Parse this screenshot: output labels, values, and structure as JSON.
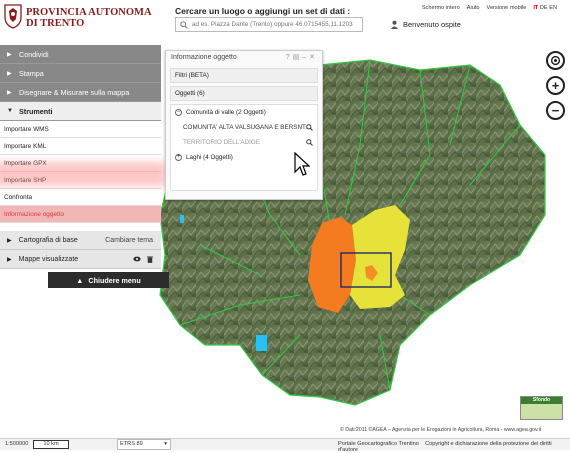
{
  "header": {
    "brand_line1": "PROVINCIA AUTONOMA",
    "brand_line2": "DI TRENTO",
    "search_title": "Cercare un luogo o aggiungi un set di dati :",
    "search_placeholder": "ad es. Piazza Dante (Trento) oppure 46.0715455,11.1203",
    "user_label": "Benvenuto ospite",
    "top_links": [
      "Schermo intero",
      "Aiuto",
      "Versione mobile"
    ],
    "lang_it": "IT",
    "lang_de": "DE",
    "lang_en": "EN"
  },
  "menu": {
    "items": [
      {
        "label": "Condividi"
      },
      {
        "label": "Stampa"
      },
      {
        "label": "Disegnare & Misurare sulla mappa"
      }
    ],
    "tools_label": "Strumenti",
    "tools": [
      {
        "label": "Importare WMS"
      },
      {
        "label": "Importare KML"
      },
      {
        "label": "Importare GPX"
      },
      {
        "label": "Importare SHP"
      },
      {
        "label": "Confronta"
      },
      {
        "label": "Informazione oggetto"
      }
    ],
    "base_map_label": "Cartografia di base",
    "change_theme_label": "Cambiare tema",
    "visible_maps_label": "Mappe visualizzate",
    "close_menu_label": "Chiudere menu"
  },
  "info_panel": {
    "title": "Informazione oggetto",
    "filter_label": "Filtri (BETA)",
    "objects_label": "Oggetti (6)",
    "group1_label": "Comunità di valle (2 Oggetti)",
    "group1_items": [
      "COMUNITA' ALTA VALSUGANA E BERSNT...",
      "TERRITORIO DELL'ADIGE"
    ],
    "group2_label": "Laghi (4 Oggetti)"
  },
  "map": {
    "credits": "© Dati:2011 ©AGEA – Agenzia per le Erogazioni in Agricoltura, Roma - www.agea.gov.it",
    "background_label": "Sfondo",
    "colors": {
      "region_orange": "#f47b20",
      "region_yellow": "#e6e23a",
      "borders": "#2ecc40"
    }
  },
  "footer": {
    "scale": "1:500000",
    "scale_bar": "10 km",
    "crs": "ETRS 89",
    "portal": "Portale Geocartografico Trentino",
    "copyright": "Copyright e dichiarazione della protezione dei diritti d'autore"
  }
}
